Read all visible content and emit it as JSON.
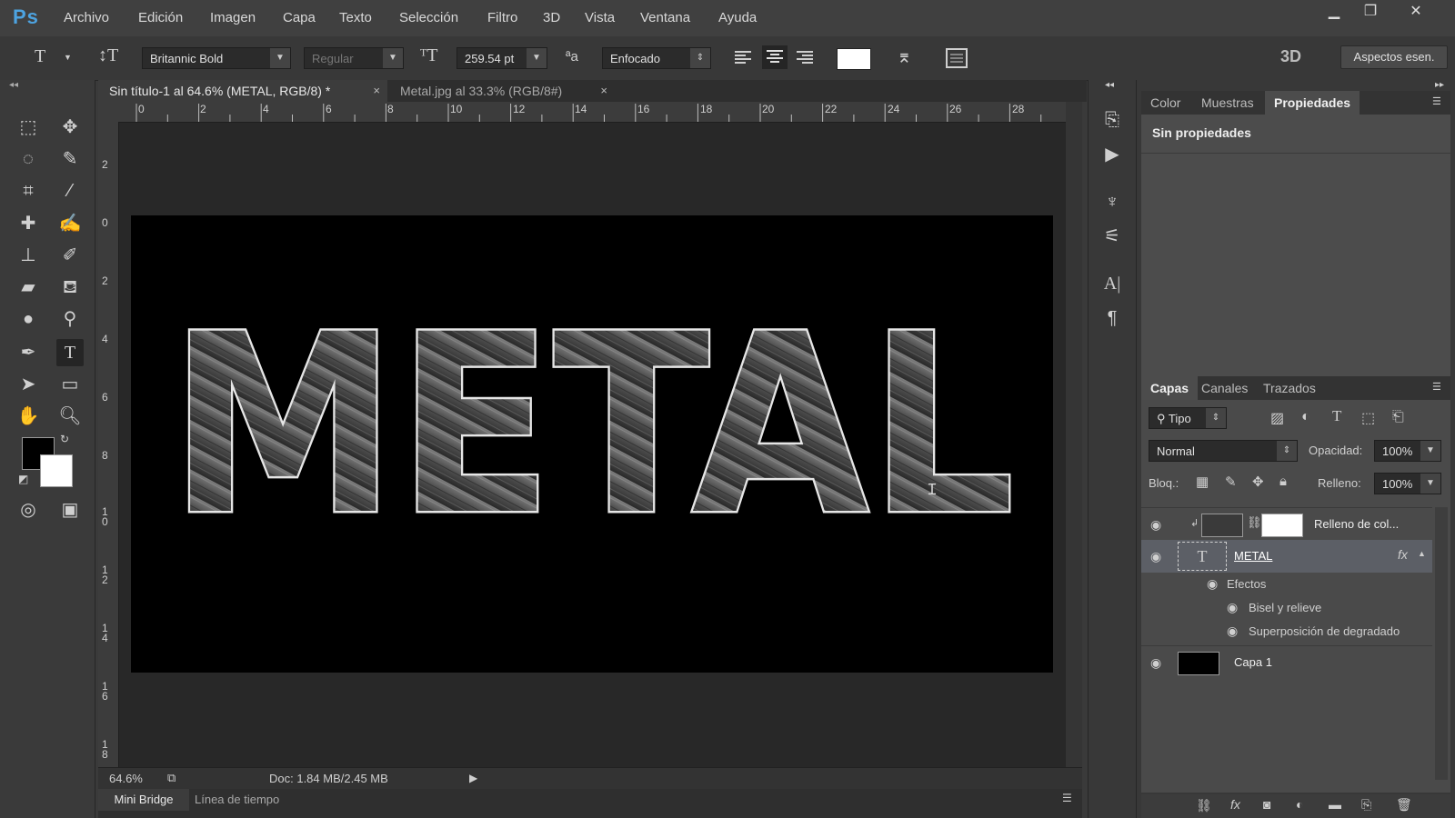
{
  "app": {
    "logo": "Ps"
  },
  "menu": [
    "Archivo",
    "Edición",
    "Imagen",
    "Capa",
    "Texto",
    "Selección",
    "Filtro",
    "3D",
    "Vista",
    "Ventana",
    "Ayuda"
  ],
  "window_buttons": {
    "minimize": "▁",
    "restore": "❐",
    "close": "✕"
  },
  "options": {
    "font_family": "Britannic Bold",
    "font_style": "Regular",
    "font_size": "259.54 pt",
    "aa_label": "ªa",
    "antialias": "Enfocado",
    "text_color": "#ffffff",
    "mode_3d": "3D",
    "workspace_button": "Aspectos esen."
  },
  "doc_tabs": [
    {
      "label": "Sin título-1 al 64.6% (METAL, RGB/8) *",
      "close": "×"
    },
    {
      "label": "Metal.jpg al 33.3% (RGB/8#)",
      "close": "×"
    }
  ],
  "ruler_h": [
    "0",
    "2",
    "4",
    "6",
    "8",
    "10",
    "12",
    "14",
    "16",
    "18",
    "20",
    "22",
    "24",
    "26",
    "28"
  ],
  "ruler_v": [
    "2",
    "0",
    "2",
    "4",
    "6",
    "8",
    "1 0",
    "1 2",
    "1 4",
    "1 6",
    "1 8"
  ],
  "canvas_text": "METAL",
  "status": {
    "zoom": "64.6%",
    "doc": "Doc: 1.84 MB/2.45 MB"
  },
  "bottom_tabs": [
    "Mini Bridge",
    "Línea de tiempo"
  ],
  "props_tabs": [
    "Color",
    "Muestras",
    "Propiedades"
  ],
  "props_empty": "Sin propiedades",
  "layers_tabs": [
    "Capas",
    "Canales",
    "Trazados"
  ],
  "layers": {
    "filter_kind": "Tipo",
    "blend_mode": "Normal",
    "opacity_label": "Opacidad:",
    "opacity": "100%",
    "lock_label": "Bloq.:",
    "fill_label": "Relleno:",
    "fill": "100%",
    "items": [
      {
        "name": "Relleno de col..."
      },
      {
        "name": "METAL",
        "fx": "fx"
      },
      {
        "name": "Efectos"
      },
      {
        "name": "Bisel y relieve"
      },
      {
        "name": "Superposición de degradado"
      },
      {
        "name": "Capa 1"
      }
    ]
  },
  "colors": {
    "accent": "#4da3e0",
    "selected_layer": "#5c5f66",
    "canvas": "#000000"
  }
}
